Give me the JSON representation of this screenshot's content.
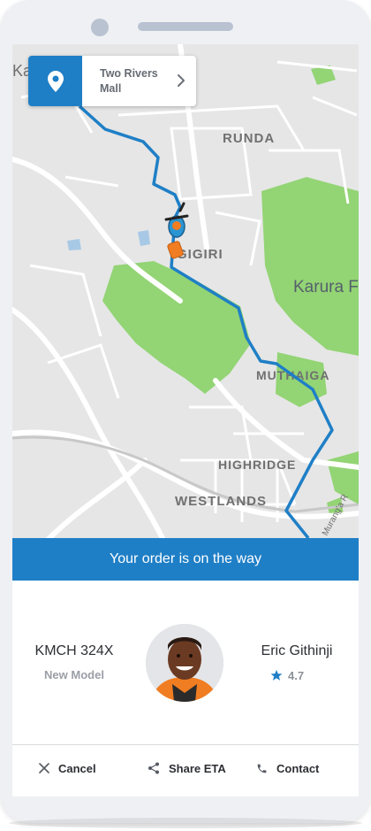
{
  "map": {
    "labels": {
      "corner_fragment": "Ka",
      "runda": "RUNDA",
      "gigiri": "GIGIRI",
      "karura": "Karura F",
      "muthaiga": "MUTHAIGA",
      "highridge": "HIGHRIDGE",
      "westlands": "WESTLANDS",
      "murang_road": "Murang'a R"
    },
    "destination": {
      "label": "Two Rivers Mall",
      "pin_icon": "location-pin-icon",
      "chevron_icon": "chevron-right-icon"
    },
    "route_color": "#1f7fc6",
    "park_color": "#93d475",
    "rider_icon": "delivery-rider-icon"
  },
  "status": {
    "message": "Your order is on the way",
    "color": "#1f7fc6"
  },
  "vehicle": {
    "plate": "KMCH 324X",
    "model": "New Model"
  },
  "driver": {
    "name": "Eric Githinji",
    "rating": "4.7",
    "avatar_icon": "driver-avatar",
    "star_icon": "star-icon"
  },
  "actions": {
    "cancel": {
      "label": "Cancel",
      "icon": "close-icon"
    },
    "share": {
      "label": "Share ETA",
      "icon": "share-icon"
    },
    "contact": {
      "label": "Contact",
      "icon": "phone-icon"
    }
  }
}
